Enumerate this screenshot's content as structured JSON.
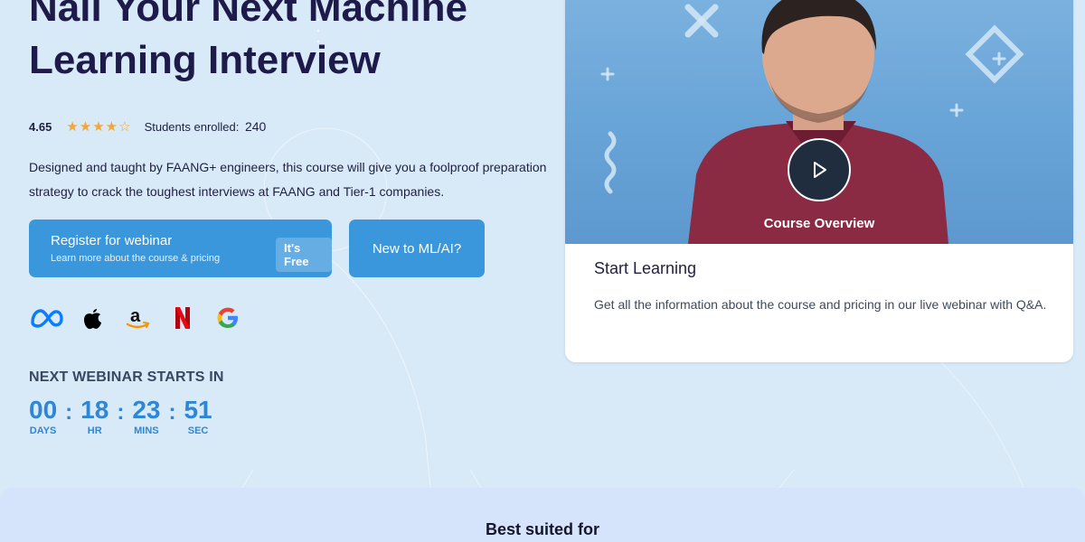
{
  "hero": {
    "title": "Nail Your Next Machine Learning Interview",
    "rating": "4.65",
    "stars": "★★★★☆",
    "enrolled_label": "Students enrolled:",
    "enrolled_count": "240",
    "description": "Designed and taught by FAANG+ engineers, this course will give you a foolproof preparation strategy to crack the toughest interviews at FAANG and Tier-1 companies."
  },
  "register_button": {
    "title": "Register for webinar",
    "subtitle": "Learn more about the course & pricing",
    "badge": "It's Free"
  },
  "new_button": {
    "label": "New to ML/AI?"
  },
  "company_logos": [
    "meta-logo",
    "apple-logo",
    "amazon-logo",
    "netflix-logo",
    "google-logo"
  ],
  "webinar": {
    "heading": "NEXT WEBINAR STARTS IN",
    "days": "00",
    "days_label": "DAYS",
    "hours": "18",
    "hours_label": "HR",
    "mins": "23",
    "mins_label": "MINS",
    "secs": "51",
    "secs_label": "SEC",
    "separator": ":"
  },
  "course_card": {
    "video_caption": "Course Overview",
    "title": "Start Learning",
    "text": "Get all the information about the course and pricing in our live webinar with Q&A."
  },
  "bottom": {
    "heading": "Best suited for"
  },
  "colors": {
    "page_background": "#d8e9f7",
    "accent_blue": "#3b97dc",
    "title_navy": "#1e1b4b",
    "countdown_blue": "#2f86d6",
    "star_orange": "#f2a53a",
    "netflix_red": "#e50914",
    "meta_blue": "#0a7cff"
  }
}
